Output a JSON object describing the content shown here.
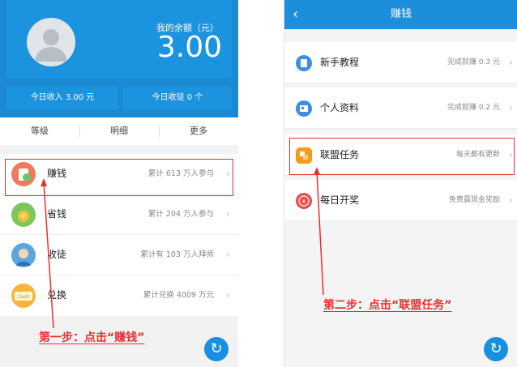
{
  "left": {
    "balance_label": "我的余额（元）",
    "balance": "3.00",
    "today_income": "今日收入 3.00 元",
    "today_apprentices": "今日收徒 0 个",
    "tabs": [
      "等级",
      "明细",
      "更多"
    ],
    "items": [
      {
        "label": "赚钱",
        "meta": "累计 613 万人参与"
      },
      {
        "label": "省钱",
        "meta": "累计 204 万人参与"
      },
      {
        "label": "收徒",
        "meta": "累计有 103 万人拜师"
      },
      {
        "label": "兑换",
        "meta": "累计兑换 4009 万元"
      }
    ],
    "cash_badge": "Cash",
    "annotation": "第一步：点击“赚钱”"
  },
  "right": {
    "title": "赚钱",
    "items": [
      {
        "label": "新手教程",
        "meta": "完成就赚 0.3 元"
      },
      {
        "label": "个人资料",
        "meta": "完成就赚 0.2 元"
      },
      {
        "label": "联盟任务",
        "meta": "每天都有更新"
      },
      {
        "label": "每日开奖",
        "meta": "免费赢现金奖励"
      }
    ],
    "annotation": "第二步：点击“联盟任务”"
  },
  "glyphs": {
    "chevron": "›",
    "back": "‹",
    "refresh": "↻",
    "yen": "¥"
  },
  "colors": {
    "primary": "#1b8ad2",
    "annotation": "#e53030"
  }
}
